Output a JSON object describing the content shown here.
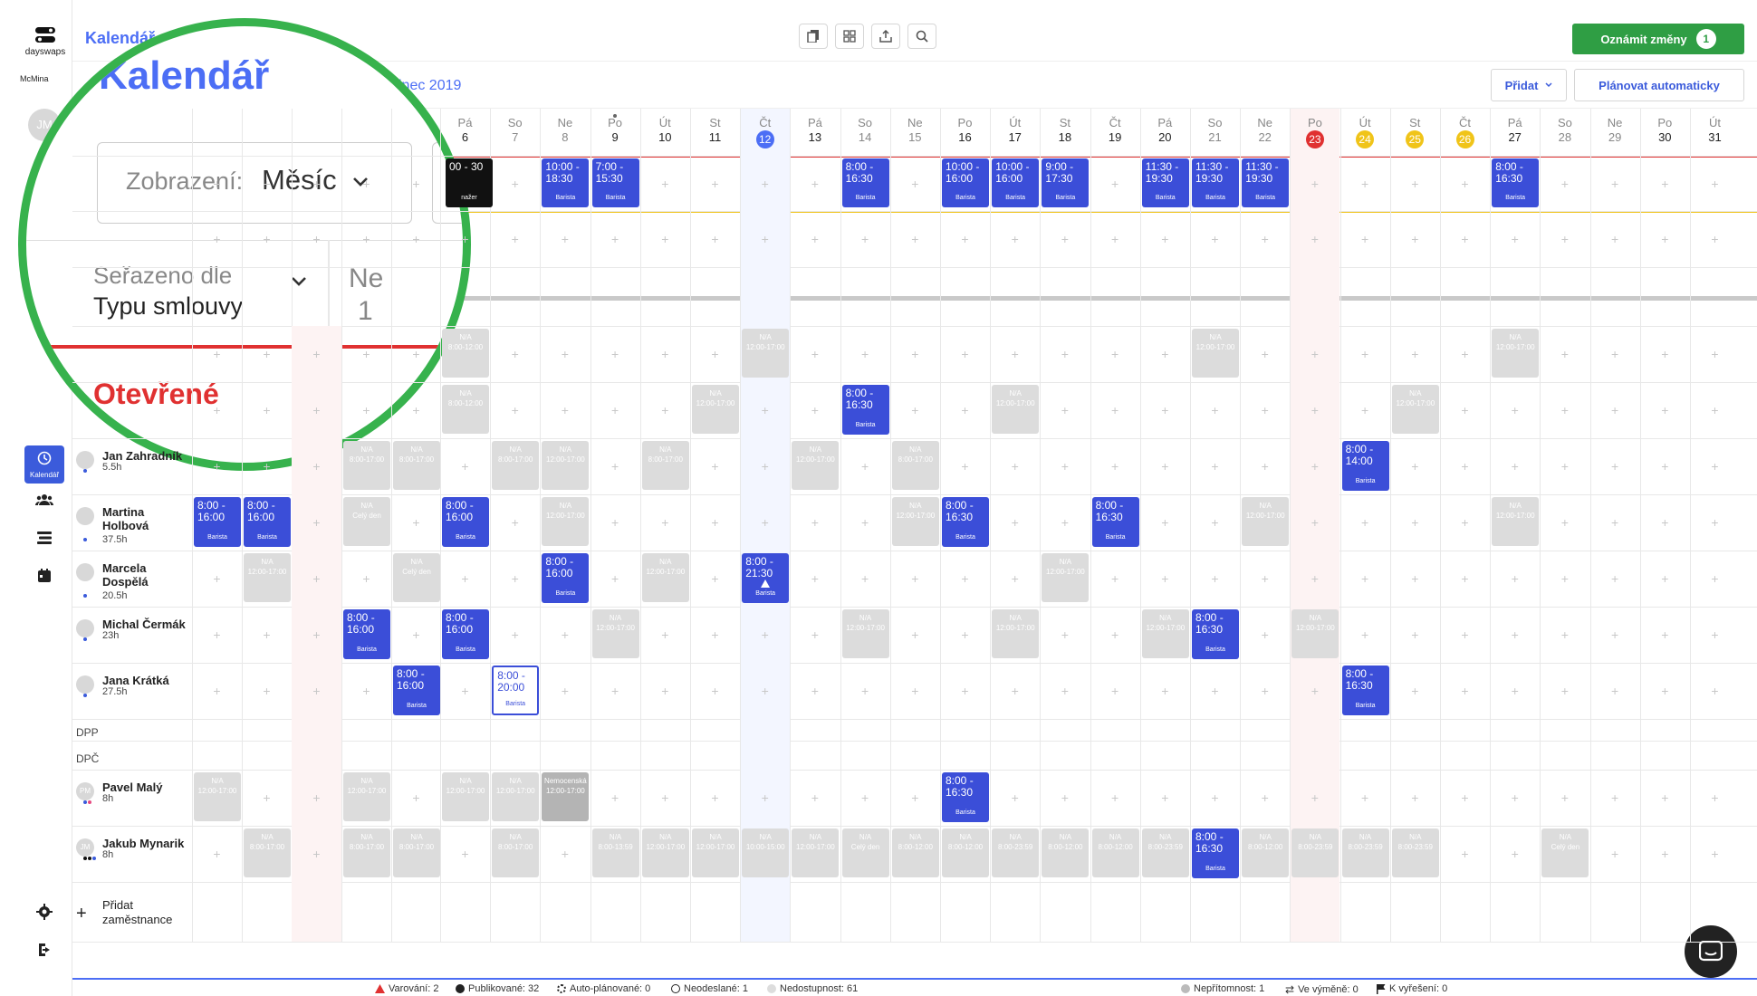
{
  "sidebar": {
    "logo_text": "dayswaps",
    "brand": "McMina",
    "avatar": "JM",
    "nav_calendar_label": "Kalendář"
  },
  "header": {
    "title": "Kalendář",
    "month_label": "inec 2019",
    "announce_label": "Oznámit změny",
    "announce_count": "1",
    "add_label": "Přidat",
    "auto_plan_label": "Plánovat automaticky"
  },
  "magnifier": {
    "title": "Kalendář",
    "view_label": "Zobrazení:",
    "view_value": "Měsíc",
    "sort_label": "Seřazeno dle",
    "sort_value": "Typu smlouvy",
    "first_day_name": "Ne",
    "first_day_num": "1",
    "open_label": "Otevřené"
  },
  "days": [
    {
      "n": "Pá",
      "d": "6"
    },
    {
      "n": "So",
      "d": "7",
      "we": true
    },
    {
      "n": "Ne",
      "d": "8",
      "we": true
    },
    {
      "n": "Po",
      "d": "9"
    },
    {
      "n": "Út",
      "d": "10"
    },
    {
      "n": "St",
      "d": "11"
    },
    {
      "n": "Čt",
      "d": "12",
      "badge": "#4c6ef5"
    },
    {
      "n": "Pá",
      "d": "13"
    },
    {
      "n": "So",
      "d": "14",
      "we": true
    },
    {
      "n": "Ne",
      "d": "15",
      "we": true
    },
    {
      "n": "Po",
      "d": "16"
    },
    {
      "n": "Út",
      "d": "17"
    },
    {
      "n": "St",
      "d": "18"
    },
    {
      "n": "Čt",
      "d": "19"
    },
    {
      "n": "Pá",
      "d": "20"
    },
    {
      "n": "So",
      "d": "21",
      "we": true
    },
    {
      "n": "Ne",
      "d": "22",
      "we": true
    },
    {
      "n": "Po",
      "d": "23",
      "badge": "#e03131"
    },
    {
      "n": "Út",
      "d": "24",
      "badge": "#f0c419"
    },
    {
      "n": "St",
      "d": "25",
      "badge": "#f0c419"
    },
    {
      "n": "Čt",
      "d": "26",
      "badge": "#f0c419"
    },
    {
      "n": "Pá",
      "d": "27"
    },
    {
      "n": "So",
      "d": "28",
      "we": true
    },
    {
      "n": "Ne",
      "d": "29",
      "we": true
    },
    {
      "n": "Po",
      "d": "30"
    },
    {
      "n": "Út",
      "d": "31"
    }
  ],
  "employees": [
    {
      "name": "Jan Zahradník",
      "hours": "5.5h",
      "dots": [
        "#3b5bdb"
      ]
    },
    {
      "name": "Martina Holbová",
      "hours": "37.5h",
      "dots": [
        "#3b5bdb"
      ]
    },
    {
      "name": "Marcela Dospělá",
      "hours": "20.5h",
      "dots": [
        "#3b5bdb"
      ]
    },
    {
      "name": "Michal Čermák",
      "hours": "23h",
      "dots": [
        "#3b5bdb"
      ]
    },
    {
      "name": "Jana Krátká",
      "hours": "27.5h",
      "dots": [
        "#3b5bdb"
      ]
    },
    {
      "name": "Pavel Malý",
      "hours": "8h",
      "dots": [
        "#3b5bdb",
        "#e64980"
      ],
      "av": "PM"
    },
    {
      "name": "Jakub Mynarik",
      "hours": "8h",
      "dots": [
        "#111",
        "#111",
        "#3b5bdb"
      ],
      "av": "JM"
    }
  ],
  "sections": {
    "dpp": "DPP",
    "dpc": "DPČ"
  },
  "shifts": [
    {
      "t": "10:00 - 18:30",
      "r": "Barista"
    },
    {
      "t": "7:00 - 15:30",
      "r": "Barista"
    },
    {
      "t": "8:00 - 16:30",
      "r": "Barista"
    },
    {
      "t": "10:00 - 16:00",
      "r": "Barista"
    },
    {
      "t": "8:00 - 16:00",
      "r": "Barista"
    },
    {
      "t": "9:00 - 17:30",
      "r": "Barista"
    },
    {
      "t": "11:30 - 19:30",
      "r": "Barista"
    },
    {
      "t": "8:00 - 21:30",
      "r": "Barista"
    },
    {
      "t": "8:00 - 14:00",
      "r": "Barista"
    },
    {
      "t": "8:00 - 20:00",
      "r": "Barista"
    },
    {
      "t": "00 - 30",
      "r": "nažer"
    }
  ],
  "na": {
    "label": "N/A",
    "full_day": "Celý den",
    "sick": "Nemocenská",
    "t1": "8:00-12:00",
    "t2": "12:00-17:00",
    "t3": "8:00-17:00",
    "t4": "10:00-15:00",
    "t5": "8:00-13:59",
    "t6": "8:00-23:59"
  },
  "add_employee": "Přidat zaměstnance",
  "status": {
    "warnings": "Varování: 2",
    "published": "Publikované: 32",
    "auto": "Auto-plánované: 0",
    "unsent": "Neodeslané: 1",
    "unavailable": "Nedostupnost: 61",
    "absence": "Nepřítomnost: 1",
    "swap": "Ve výměně: 0",
    "resolve": "K vyřešení: 0"
  },
  "colors": {
    "primary": "#3b4ed8",
    "accent": "#4c6ef5",
    "green": "#2f9e44",
    "ring": "#37b24d",
    "red": "#e03131",
    "yellow": "#f0c419"
  }
}
